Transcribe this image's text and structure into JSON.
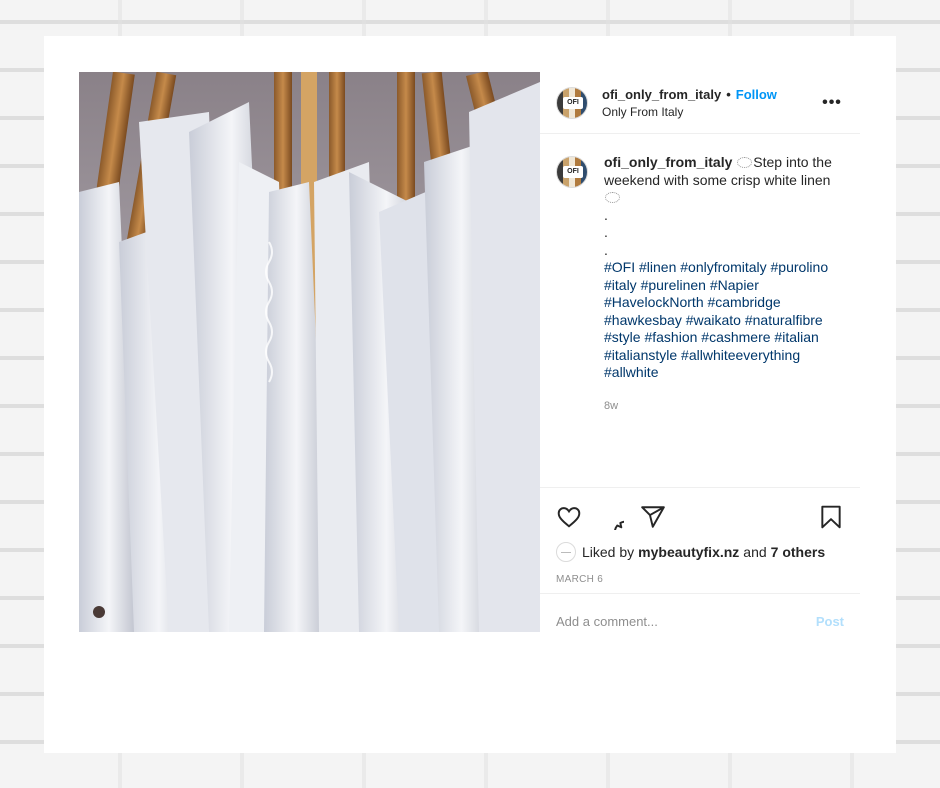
{
  "post": {
    "username": "ofi_only_from_italy",
    "follow_label": "Follow",
    "location": "Only From Italy",
    "more_label": "•••",
    "avatar_text": "OFI",
    "caption_text_1": "Step into the weekend with some crisp white linen",
    "caption_dots": [
      ".",
      ".",
      "."
    ],
    "hashtags": "#OFI #linen #onlyfromitaly #purolino #italy #purelinen #Napier #HavelockNorth #cambridge #hawkesbay #waikato #naturalfibre #style #fashion #cashmere #italian #italianstyle #allwhiteeverything #allwhite",
    "age": "8w",
    "liked_prefix": "Liked by",
    "liked_user": "mybeautyfix.nz",
    "liked_and": "and",
    "liked_others": "7 others",
    "date": "MARCH 6",
    "comment_placeholder": "Add a comment...",
    "post_label": "Post"
  },
  "icons": [
    "heart-icon",
    "comment-icon",
    "share-icon",
    "bookmark-icon",
    "more-icon"
  ],
  "colors": {
    "link": "#0095f6",
    "hashtag": "#00376b",
    "post_disabled": "#b2dffc",
    "muted": "#8e8e8e"
  }
}
